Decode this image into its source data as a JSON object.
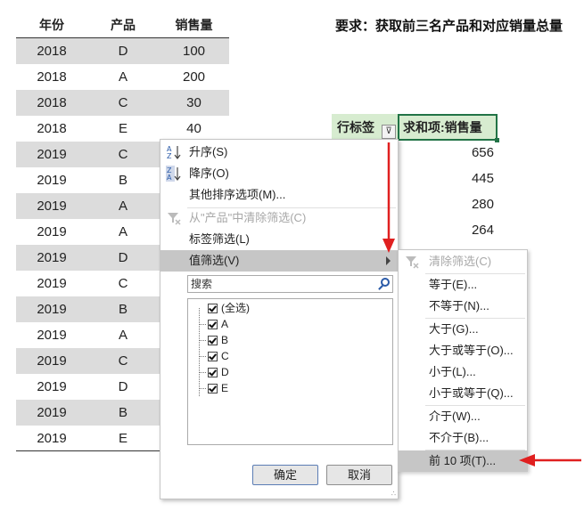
{
  "table": {
    "headers": [
      "年份",
      "产品",
      "销售量"
    ],
    "rows": [
      [
        "2018",
        "D",
        "100"
      ],
      [
        "2018",
        "A",
        "200"
      ],
      [
        "2018",
        "C",
        "30"
      ],
      [
        "2018",
        "E",
        "40"
      ],
      [
        "2019",
        "C",
        ""
      ],
      [
        "2019",
        "B",
        ""
      ],
      [
        "2019",
        "A",
        ""
      ],
      [
        "2019",
        "A",
        ""
      ],
      [
        "2019",
        "D",
        ""
      ],
      [
        "2019",
        "C",
        ""
      ],
      [
        "2019",
        "B",
        ""
      ],
      [
        "2019",
        "A",
        ""
      ],
      [
        "2019",
        "C",
        ""
      ],
      [
        "2019",
        "D",
        ""
      ],
      [
        "2019",
        "B",
        ""
      ],
      [
        "2019",
        "E",
        ""
      ]
    ]
  },
  "requirement": "要求：获取前三名产品和对应销量总量",
  "pivot": {
    "row_header": "行标签",
    "value_header": "求和项:销售量",
    "values": [
      "656",
      "445",
      "280",
      "264"
    ]
  },
  "menu": {
    "sort_asc": "升序(S)",
    "sort_desc": "降序(O)",
    "more_sort": "其他排序选项(M)...",
    "clear_filter": "从\"产品\"中清除筛选(C)",
    "label_filter": "标签筛选(L)",
    "value_filter": "值筛选(V)",
    "search_placeholder": "搜索",
    "check_items": [
      "(全选)",
      "A",
      "B",
      "C",
      "D",
      "E"
    ],
    "ok": "确定",
    "cancel": "取消"
  },
  "submenu": {
    "items": [
      "清除筛选(C)",
      "等于(E)...",
      "不等于(N)...",
      "大于(G)...",
      "大于或等于(O)...",
      "小于(L)...",
      "小于或等于(Q)...",
      "介于(W)...",
      "不介于(B)...",
      "前 10 项(T)..."
    ]
  },
  "colors": {
    "pivot_header": "#d7ecd0",
    "accent_border": "#217346",
    "arrow": "#e02020",
    "highlight": "#c6c6c6"
  }
}
